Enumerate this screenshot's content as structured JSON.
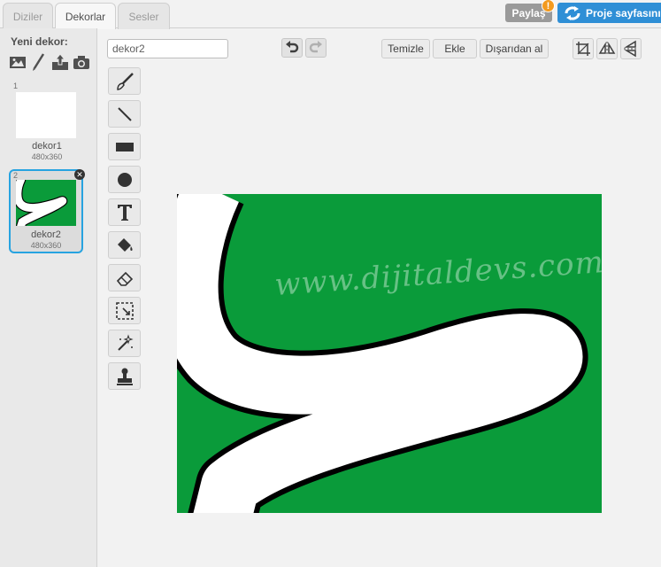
{
  "tabs": [
    {
      "label": "Diziler",
      "active": false
    },
    {
      "label": "Dekorlar",
      "active": true
    },
    {
      "label": "Sesler",
      "active": false
    }
  ],
  "header": {
    "share_label": "Paylaş",
    "share_badge": "!",
    "project_label": "Proje sayfasını"
  },
  "left_panel": {
    "new_label": "Yeni dekor:",
    "new_icons": [
      "image-icon",
      "paintbrush-icon",
      "upload-icon",
      "camera-icon"
    ]
  },
  "costumes": [
    {
      "number": "1",
      "name": "dekor1",
      "size": "480x360",
      "selected": false
    },
    {
      "number": "2",
      "name": "dekor2",
      "size": "480x360",
      "selected": true
    }
  ],
  "editor": {
    "name_value": "dekor2",
    "clear_label": "Temizle",
    "add_label": "Ekle",
    "import_label": "Dışarıdan al",
    "tools": [
      "brush-icon",
      "line-icon",
      "rectangle-icon",
      "ellipse-icon",
      "text-icon",
      "fill-icon",
      "eraser-icon",
      "select-icon",
      "select-remove-icon",
      "stamp-icon"
    ]
  },
  "canvas": {
    "watermark": "www.dijitaldevs.com",
    "background_color": "#0a9b3a",
    "road_color": "#ffffff"
  }
}
